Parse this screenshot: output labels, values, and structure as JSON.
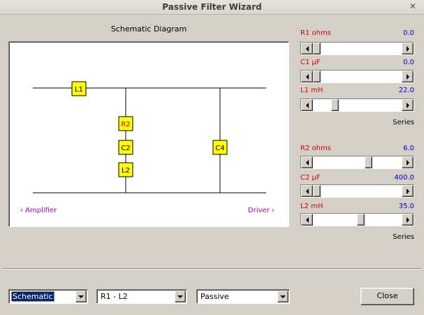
{
  "window": {
    "title": "Passive Filter Wizard",
    "close_glyph": "✕"
  },
  "diagram": {
    "title": "Schematic Diagram",
    "components": [
      "L1",
      "R2",
      "C2",
      "L2",
      "C4"
    ],
    "left_link": "‹  Amplifier",
    "right_link": "Driver  ›"
  },
  "groups": [
    {
      "sliders": [
        {
          "label": "R1  ohms",
          "value": "0.0",
          "position": 0.0
        },
        {
          "label": "C1  µF",
          "value": "0.0",
          "position": 0.0
        },
        {
          "label": "L1  mH",
          "value": "22.0",
          "position": 0.22
        }
      ],
      "mode": "Series"
    },
    {
      "sliders": [
        {
          "label": "R2  ohms",
          "value": "6.0",
          "position": 0.64
        },
        {
          "label": "C2  µF",
          "value": "400.0",
          "position": 0.0
        },
        {
          "label": "L2  mH",
          "value": "35.0",
          "position": 0.54
        }
      ],
      "mode": "Series"
    }
  ],
  "bottom": {
    "view_select": "Schematic",
    "section_select": "R1 - L2",
    "type_select": "Passive",
    "close_label": "Close"
  },
  "colors": {
    "component_fill": "#ffff00",
    "label_red": "#d40000",
    "value_blue": "#0000d0",
    "link_magenta": "#b000b0"
  }
}
